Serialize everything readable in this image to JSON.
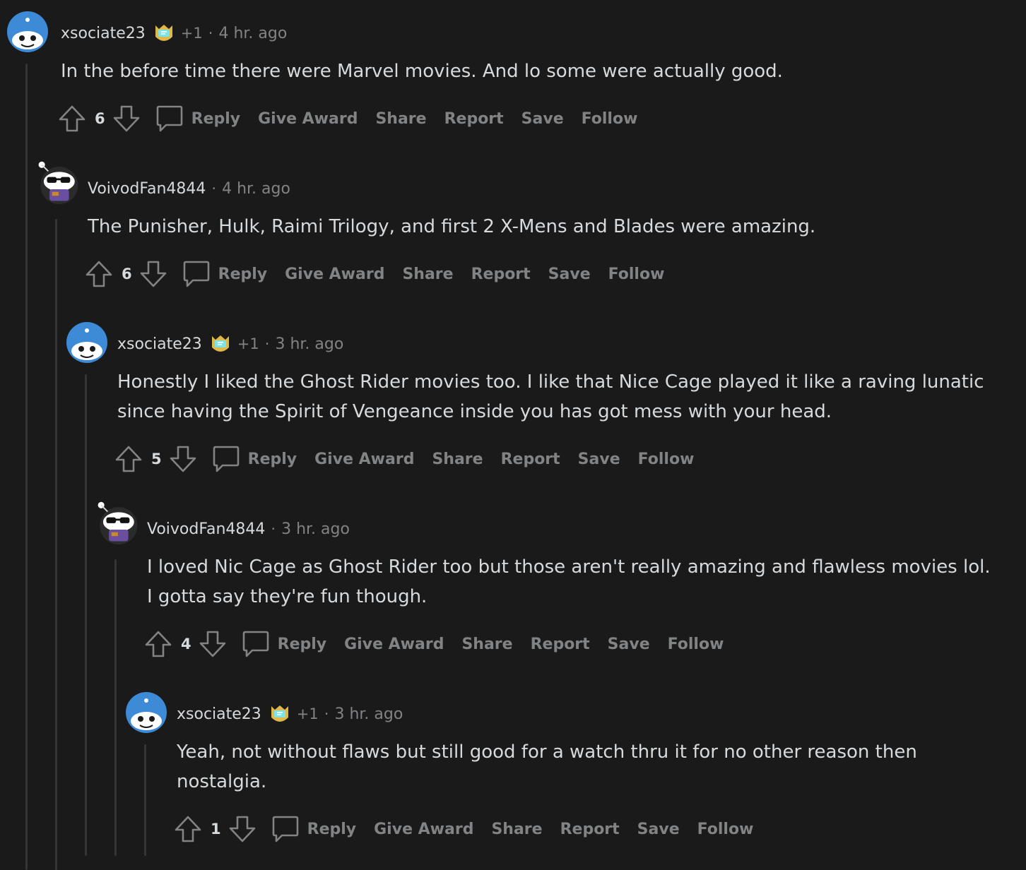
{
  "labels": {
    "reply": "Reply",
    "give_award": "Give Award",
    "share": "Share",
    "report": "Report",
    "save": "Save",
    "follow": "Follow"
  },
  "comments": [
    {
      "username": "xsociate23",
      "flair_icon": "award-badge-icon",
      "plus": "+1",
      "time": "4 hr. ago",
      "text_lines": [
        "In the before time there were Marvel movies. And lo some were actually good."
      ],
      "score": "6",
      "avatar": "snoo-blue-avatar"
    },
    {
      "username": "VoivodFan4844",
      "time": "4 hr. ago",
      "text_lines": [
        "The Punisher, Hulk, Raimi Trilogy, and first 2 X-Mens and Blades were amazing."
      ],
      "score": "6",
      "avatar": "snoo-sunglasses-avatar"
    },
    {
      "username": "xsociate23",
      "flair_icon": "award-badge-icon",
      "plus": "+1",
      "time": "3 hr. ago",
      "text_lines": [
        "Honestly I liked the Ghost Rider movies too. I like that Nice Cage played it like a raving lunatic",
        "since having the Spirit of Vengeance inside you has got mess with your head."
      ],
      "score": "5",
      "avatar": "snoo-blue-avatar"
    },
    {
      "username": "VoivodFan4844",
      "time": "3 hr. ago",
      "text_lines": [
        "I loved Nic Cage as Ghost Rider too but those aren't really amazing and flawless movies lol.",
        "I gotta say they're fun though."
      ],
      "score": "4",
      "avatar": "snoo-sunglasses-avatar"
    },
    {
      "username": "xsociate23",
      "flair_icon": "award-badge-icon",
      "plus": "+1",
      "time": "3 hr. ago",
      "text_lines": [
        "Yeah, not without flaws but still good for a watch thru it for no other reason then",
        "nostalgia."
      ],
      "score": "1",
      "avatar": "snoo-blue-avatar"
    }
  ],
  "colors": {
    "background": "#1a1a1b",
    "text": "#d7dadc",
    "muted": "#818384",
    "thread_line": "#343536",
    "avatar_blue": "#3d8ad6"
  }
}
